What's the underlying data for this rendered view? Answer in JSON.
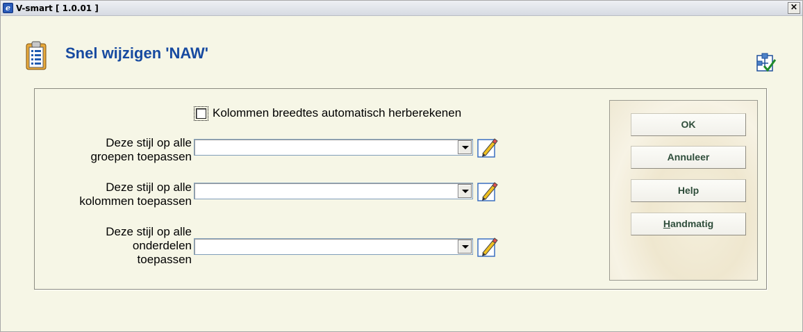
{
  "window": {
    "title": "V-smart [ 1.0.01 ]",
    "app_icon": "e",
    "close_glyph": "×",
    "icons": {
      "app": "app-logo-icon",
      "close": "close-icon"
    }
  },
  "header": {
    "title": "Snel wijzigen 'NAW'",
    "icons": {
      "page": "clipboard-list-icon",
      "settings": "settings-checkmark-icon"
    },
    "title_color": "#174aa0"
  },
  "form": {
    "auto_width": {
      "label": "Kolommen breedtes automatisch herberekenen",
      "checked": false
    },
    "fields": [
      {
        "label": "Deze stijl op alle\ngroepen toepassen",
        "value": ""
      },
      {
        "label": "Deze stijl op alle\nkolommen toepassen",
        "value": ""
      },
      {
        "label": "Deze stijl op alle\nonderdelen\ntoepassen",
        "value": ""
      }
    ],
    "edit_icon": "pencil-edit-icon"
  },
  "buttons": {
    "ok": "OK",
    "cancel": "Annuleer",
    "help": "Help",
    "manual_mnemonic": "H",
    "manual_rest": "andmatig"
  },
  "colors": {
    "background": "#f6f6e6",
    "button_text": "#2e4d3a"
  }
}
